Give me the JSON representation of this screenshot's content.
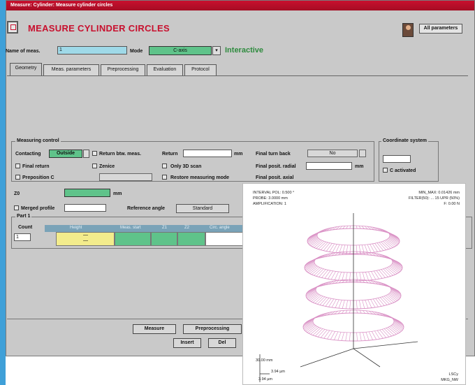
{
  "window": {
    "title": "Measure: Cylinder: Measure cylinder circles"
  },
  "header": {
    "title": "MEASURE CYLINDER CIRCLES",
    "all_params_label": "All parameters"
  },
  "form": {
    "name_label": "Name of meas.",
    "name_value": "1",
    "mode_label": "Mode",
    "mode_value": "C-axis",
    "mode_status": "Interactive"
  },
  "tabs": [
    {
      "label": "Geometry"
    },
    {
      "label": "Meas. parameters"
    },
    {
      "label": "Preprocessing"
    },
    {
      "label": "Evaluation"
    },
    {
      "label": "Protocol"
    }
  ],
  "measuring_control": {
    "title": "Measuring control",
    "contacting_label": "Contacting",
    "contacting_value": "Outside",
    "return_btw_label": "Return btw. meas.",
    "return_label": "Return",
    "unit_mm": "mm",
    "final_turn_back_label": "Final turn back",
    "final_turn_back_value": "No",
    "final_return_label": "Final return",
    "zenice_label": "Zenice",
    "only_3d_scan_label": "Only 3D scan",
    "final_posit_radial_label": "Final posit. radial",
    "preposition_c_label": "Preposition C",
    "restore_mode_label": "Restore measuring mode",
    "final_posit_axial_label": "Final posit. axial"
  },
  "coordinate_system": {
    "title": "Coordinate system",
    "activated_label": "C activated"
  },
  "geometry": {
    "z_label": "Z0",
    "z_unit": "mm",
    "merged_profile_label": "Merged profile",
    "reference_angle_label": "Reference angle",
    "reference_angle_value": "Standard",
    "part_title": "Part 1",
    "count_label": "Count",
    "count_value": "1",
    "table_headers": [
      "Height",
      "Meas. start",
      "Z1",
      "Z2",
      "Circ. angle"
    ],
    "table_cells": [
      "—",
      "—"
    ]
  },
  "buttons": {
    "measure": "Measure",
    "preprocessing": "Preprocessing",
    "insert": "Insert",
    "delete": "Del"
  },
  "plot": {
    "line1_left": "INTERVAL POL: 0.500 °",
    "line2_left": "PROBE: 3.0000 mm",
    "line3_left": "AMPLIFICATION: 1",
    "line1_right": "MIN_MAX: 0.01426 mm",
    "line2_right": "FILTER(50): ... 15 UPR (50%)",
    "line3_right": "F: 0.00 N",
    "scale_z": "30.00 mm",
    "scale_a": "3.94 µm",
    "scale_b": "3.94 µm",
    "footer_right_1": "LSCy",
    "footer_right_2": "MKG_NW",
    "colors": {
      "rings": "#d98fc4",
      "axes": "#333333"
    }
  }
}
